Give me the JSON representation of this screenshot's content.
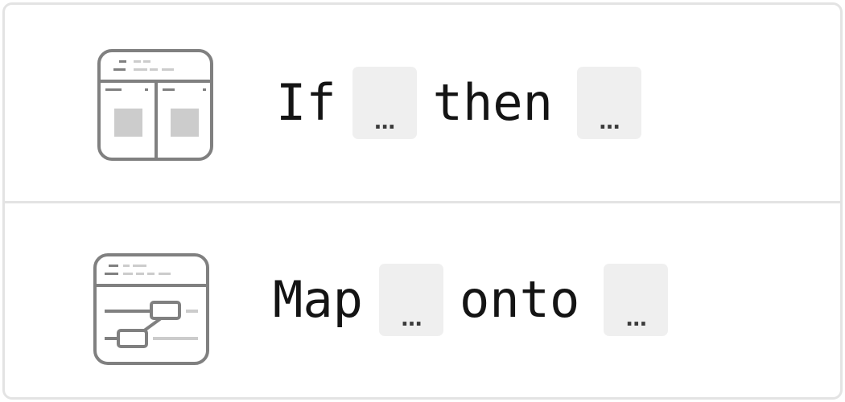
{
  "rows": [
    {
      "icon": "two-panel-layout-icon",
      "keyword1": "If",
      "keyword2": "then",
      "slot1": "…",
      "slot2": "…"
    },
    {
      "icon": "linked-flow-diagram-icon",
      "keyword1": "Map",
      "keyword2": "onto",
      "slot1": "…",
      "slot2": "…"
    }
  ],
  "colors": {
    "border": "#e3e3e3",
    "icon_stroke": "#808080",
    "icon_fill_light": "#cccccc",
    "slot_bg": "#efefef",
    "text": "#141414"
  }
}
